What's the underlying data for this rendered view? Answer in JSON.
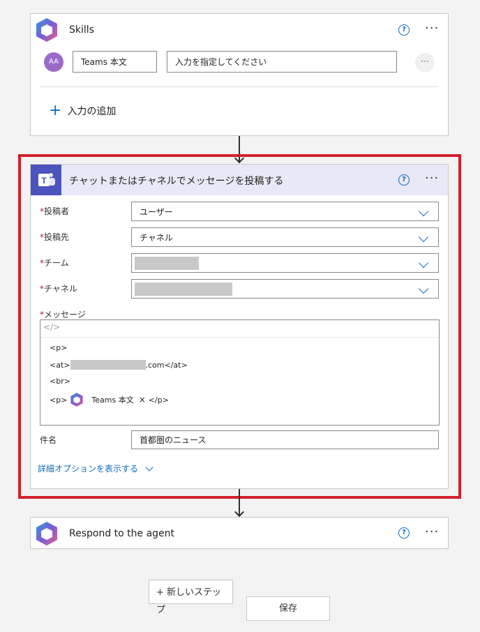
{
  "skills_card": {
    "title": "Skills",
    "help_icon": "question-icon",
    "more_icon": "more-dots-icon",
    "avatar_text": "AA",
    "input_name": "Teams 本文",
    "input_placeholder": "入力を指定してください",
    "add_input_label": "入力の追加"
  },
  "teams_card": {
    "title": "チャットまたはチャネルでメッセージを投稿する",
    "fields": {
      "poster_label": "投稿者",
      "poster_value": "ユーザー",
      "post_in_label": "投稿先",
      "post_in_value": "チャネル",
      "team_label": "チーム",
      "channel_label": "チャネル",
      "message_label": "メッセージ",
      "subject_label": "件名",
      "subject_value": "首都圏のニュース"
    },
    "message_lines": {
      "line1": "<p>",
      "line2_prefix": "<at>",
      "line2_suffix": ".com</at>",
      "line3": "<br>",
      "line4_prefix": "<p>",
      "token_label": "Teams 本文",
      "token_remove": "×",
      "line4_suffix": "</p>"
    },
    "code_toggle": "</>",
    "advanced_options": "詳細オプションを表示する"
  },
  "respond_card": {
    "title": "Respond to the agent"
  },
  "buttons": {
    "new_step": "+ 新しいステップ",
    "save": "保存"
  },
  "colors": {
    "highlight_border": "#d1202e",
    "teams_purple": "#4b53bc",
    "header_tint": "#e8e9f6",
    "link_blue": "#0f6cbd"
  }
}
